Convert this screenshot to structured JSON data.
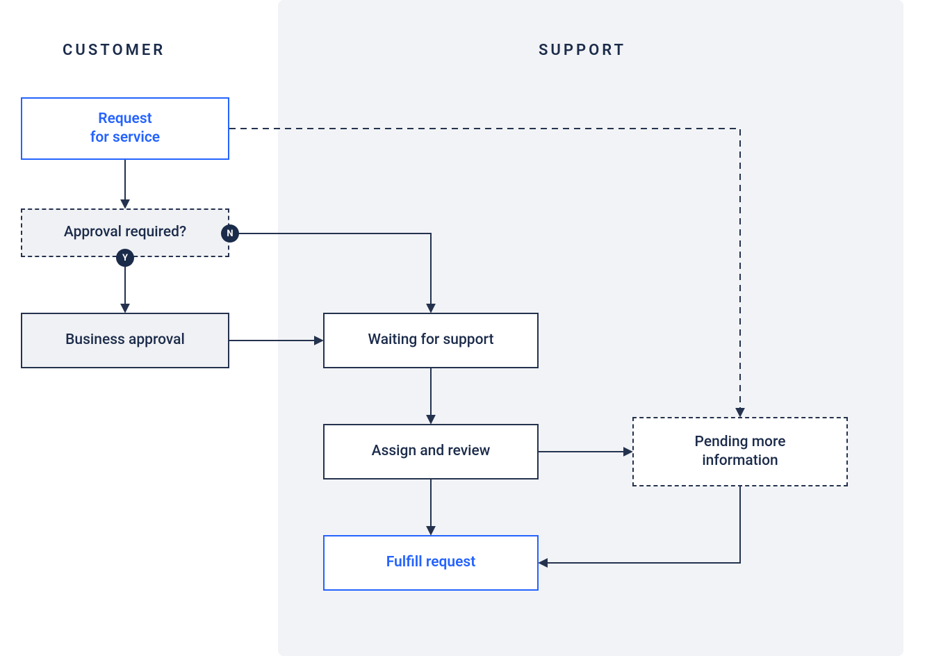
{
  "lanes": {
    "customer": "CUSTOMER",
    "support": "SUPPORT"
  },
  "nodes": {
    "request_service": "Request\nfor service",
    "approval_required": "Approval required?",
    "business_approval": "Business approval",
    "waiting_support": "Waiting for support",
    "assign_review": "Assign and review",
    "fulfill_request": "Fulfill request",
    "pending_info": "Pending more\ninformation"
  },
  "badges": {
    "yes": "Y",
    "no": "N"
  },
  "colors": {
    "navy": "#1b2b4a",
    "blue": "#2563ff",
    "support_panel": "#f2f3f6",
    "light_fill": "#f0f1f4"
  },
  "flow": {
    "edges": [
      {
        "from": "request_service",
        "to": "approval_required",
        "style": "solid",
        "label": null
      },
      {
        "from": "approval_required",
        "to": "business_approval",
        "style": "solid",
        "label": "Y"
      },
      {
        "from": "approval_required",
        "to": "waiting_support",
        "style": "solid",
        "label": "N"
      },
      {
        "from": "business_approval",
        "to": "waiting_support",
        "style": "solid",
        "label": null
      },
      {
        "from": "waiting_support",
        "to": "assign_review",
        "style": "solid",
        "label": null
      },
      {
        "from": "assign_review",
        "to": "fulfill_request",
        "style": "solid",
        "label": null
      },
      {
        "from": "assign_review",
        "to": "pending_info",
        "style": "solid",
        "label": null
      },
      {
        "from": "pending_info",
        "to": "fulfill_request",
        "style": "solid",
        "label": null
      },
      {
        "from": "request_service",
        "to": "pending_info",
        "style": "dashed",
        "label": null
      }
    ]
  }
}
